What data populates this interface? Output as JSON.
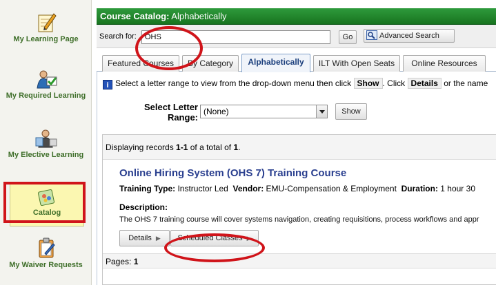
{
  "sidebar": {
    "items": [
      {
        "label": "My Learning Page",
        "icon": "pencil-notepad-icon"
      },
      {
        "label": "My Required Learning",
        "icon": "required-learning-icon"
      },
      {
        "label": "My Elective Learning",
        "icon": "elective-learning-icon"
      },
      {
        "label": "Catalog",
        "icon": "catalog-icon"
      },
      {
        "label": "My Waiver Requests",
        "icon": "waiver-clipboard-icon"
      }
    ]
  },
  "header": {
    "title_bold": "Course Catalog:",
    "title_rest": " Alphabetically"
  },
  "search": {
    "label": "Search for:",
    "value": "OHS",
    "go_label": "Go",
    "advanced_label": "Advanced Search"
  },
  "tabs": [
    {
      "label": "Featured Courses"
    },
    {
      "label": "By Category"
    },
    {
      "label": "Alphabetically"
    },
    {
      "label": "ILT With Open Seats"
    },
    {
      "label": "Online Resources"
    }
  ],
  "info": {
    "text1": "Select a letter range to view from the drop-down menu then click",
    "show": "Show",
    "text2": ". Click",
    "details": "Details",
    "text3": "or the name"
  },
  "letter_range": {
    "label": "Select Letter Range:",
    "selected": "(None)",
    "show_label": "Show"
  },
  "results": {
    "prefix": "Displaying records ",
    "range": "1-1",
    "middle": " of a total of ",
    "total": "1",
    "suffix": "."
  },
  "course": {
    "title": "Online Hiring System (OHS 7) Training Course",
    "type_label": "Training Type:",
    "type_value": "Instructor Led",
    "vendor_label": "Vendor:",
    "vendor_value": "EMU-Compensation & Employment",
    "duration_label": "Duration:",
    "duration_value": "1 hour 30",
    "description_label": "Description:",
    "description_text": "The OHS 7 training course will cover systems navigation, creating requisitions, process workflows and appr",
    "details_label": "Details",
    "scheduled_label": "Scheduled Classes"
  },
  "pages": {
    "label": "Pages:",
    "current": "1"
  },
  "colors": {
    "header_green": "#18741f",
    "sidebar_green": "#3f6f2a",
    "link_blue": "#2a3f8f",
    "annotation_red": "#d0141a",
    "catalog_highlight": "#fbf7b1"
  }
}
